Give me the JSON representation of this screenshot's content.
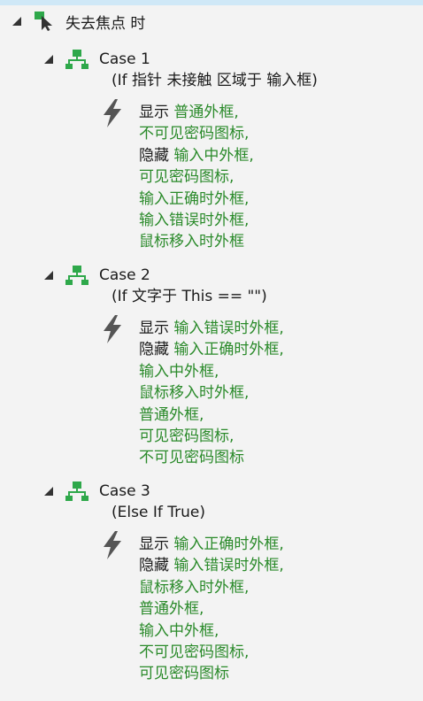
{
  "event": {
    "label": "失去焦点 时"
  },
  "cases": [
    {
      "label": "Case 1",
      "condition": "(If 指针 未接触 区域于 输入框)",
      "lines": [
        {
          "verb": "显示",
          "target": "普通外框,"
        },
        {
          "verb": "",
          "target": "不可见密码图标,"
        },
        {
          "verb": "隐藏",
          "target": "输入中外框,"
        },
        {
          "verb": "",
          "target": "可见密码图标,"
        },
        {
          "verb": "",
          "target": "输入正确时外框,"
        },
        {
          "verb": "",
          "target": "输入错误时外框,"
        },
        {
          "verb": "",
          "target": "鼠标移入时外框"
        }
      ]
    },
    {
      "label": "Case 2",
      "condition": "(If 文字于 This == \"\")",
      "lines": [
        {
          "verb": "显示",
          "target": "输入错误时外框,"
        },
        {
          "verb": "隐藏",
          "target": "输入正确时外框,"
        },
        {
          "verb": "",
          "target": "输入中外框,"
        },
        {
          "verb": "",
          "target": "鼠标移入时外框,"
        },
        {
          "verb": "",
          "target": "普通外框,"
        },
        {
          "verb": "",
          "target": "可见密码图标,"
        },
        {
          "verb": "",
          "target": "不可见密码图标"
        }
      ]
    },
    {
      "label": "Case 3",
      "condition": "(Else If True)",
      "lines": [
        {
          "verb": "显示",
          "target": "输入正确时外框,"
        },
        {
          "verb": "隐藏",
          "target": "输入错误时外框,"
        },
        {
          "verb": "",
          "target": "鼠标移入时外框,"
        },
        {
          "verb": "",
          "target": "普通外框,"
        },
        {
          "verb": "",
          "target": "输入中外框,"
        },
        {
          "verb": "",
          "target": "不可见密码图标,"
        },
        {
          "verb": "",
          "target": "可见密码图标"
        }
      ]
    }
  ],
  "colors": {
    "verb": "#1a1a1a",
    "target": "#2a8a2a",
    "case_icon": "#2ea84a",
    "event_icon": "#2ea84a",
    "bolt": "#555555"
  },
  "icons": {
    "event": "cursor-event-icon",
    "case": "case-flow-icon",
    "action": "lightning-action-icon",
    "expand": "expand-triangle-icon"
  }
}
